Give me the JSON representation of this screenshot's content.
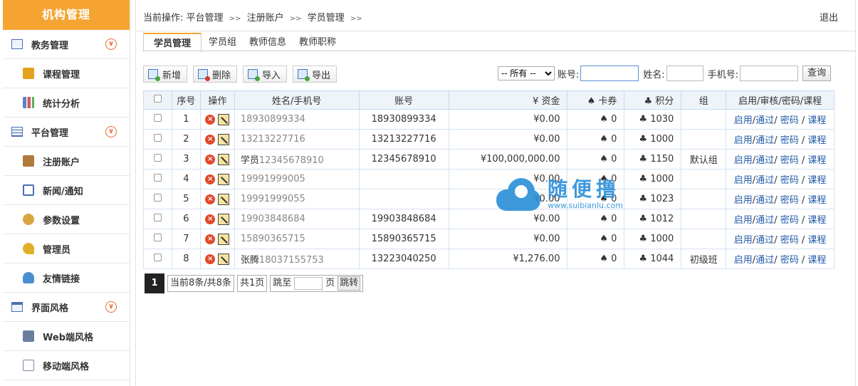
{
  "sidebar": {
    "brand": "机构管理",
    "groups": [
      {
        "label": "教务管理",
        "icon": "chart-doc-icon",
        "items": [
          {
            "label": "课程管理",
            "icon": "book-icon",
            "color": "#e3a21a"
          },
          {
            "label": "统计分析",
            "icon": "bar-chart-icon",
            "color": "#5b7fd0"
          }
        ]
      },
      {
        "label": "平台管理",
        "icon": "table-icon",
        "items": [
          {
            "label": "注册账户",
            "icon": "id-card-icon",
            "color": "#b07a3a"
          },
          {
            "label": "新闻/通知",
            "icon": "open-book-icon",
            "color": "#4a6fb0"
          },
          {
            "label": "参数设置",
            "icon": "gear-icon",
            "color": "#d9a640"
          },
          {
            "label": "管理员",
            "icon": "key-icon",
            "color": "#e0b02a"
          },
          {
            "label": "友情链接",
            "icon": "user-link-icon",
            "color": "#4a8fd0"
          }
        ]
      },
      {
        "label": "界面风格",
        "icon": "window-icon",
        "items": [
          {
            "label": "Web端风格",
            "icon": "monitor-icon",
            "color": "#6a7fa0"
          },
          {
            "label": "移动端风格",
            "icon": "line-chart-icon",
            "color": "#7a8aa0"
          }
        ]
      }
    ]
  },
  "header": {
    "crumb_prefix": "当前操作:",
    "crumbs": [
      "平台管理",
      "注册账户",
      "学员管理"
    ],
    "sep": ">>",
    "logout": "退出"
  },
  "tabs": [
    "学员管理",
    "学员组",
    "教师信息",
    "教师职称"
  ],
  "toolbar": {
    "add": "新增",
    "delete": "删除",
    "import": "导入",
    "export": "导出"
  },
  "filters": {
    "select": "-- 所有 --",
    "account_label": "账号:",
    "name_label": "姓名:",
    "phone_label": "手机号:",
    "search": "查询"
  },
  "table": {
    "headers": [
      "序号",
      "操作",
      "姓名/手机号",
      "账号",
      "¥ 资金",
      "♠ 卡券",
      "♣ 积分",
      "组",
      "启用/审核/密码/课程"
    ],
    "rows": [
      {
        "no": "1",
        "name": "",
        "phone": "18930899334",
        "account": "18930899334",
        "fund": "¥0.00",
        "card": "♠ 0",
        "points": "♣ 1030",
        "group": ""
      },
      {
        "no": "2",
        "name": "",
        "phone": "13213227716",
        "account": "13213227716",
        "fund": "¥0.00",
        "card": "♠ 0",
        "points": "♣ 1000",
        "group": ""
      },
      {
        "no": "3",
        "name": "学员",
        "phone": "12345678910",
        "account": "12345678910",
        "fund": "¥100,000,000.00",
        "card": "♠ 0",
        "points": "♣ 1150",
        "group": "默认组"
      },
      {
        "no": "4",
        "name": "",
        "phone": "19991999005",
        "account": "",
        "fund": "¥0.00",
        "card": "♠ 0",
        "points": "♣ 1000",
        "group": ""
      },
      {
        "no": "5",
        "name": "",
        "phone": "19991999055",
        "account": "",
        "fund": "¥0.00",
        "card": "♠ 0",
        "points": "♣ 1023",
        "group": ""
      },
      {
        "no": "6",
        "name": "",
        "phone": "19903848684",
        "account": "19903848684",
        "fund": "¥0.00",
        "card": "♠ 0",
        "points": "♣ 1012",
        "group": ""
      },
      {
        "no": "7",
        "name": "",
        "phone": "15890365715",
        "account": "15890365715",
        "fund": "¥0.00",
        "card": "♠ 0",
        "points": "♣ 1000",
        "group": ""
      },
      {
        "no": "8",
        "name": "张腾",
        "phone": "18037155753",
        "account": "13223040250",
        "fund": "¥1,276.00",
        "card": "♠ 0",
        "points": "♣ 1044",
        "group": "初级班"
      }
    ],
    "links": {
      "enable": "启用",
      "approve": "通过",
      "password": "密码",
      "course": "课程"
    }
  },
  "pager": {
    "current": "1",
    "summary": "当前8条/共8条",
    "pages": "共1页",
    "jump_to": "跳至",
    "page_unit": "页",
    "go": "跳转"
  },
  "watermark": {
    "cn": "随便撸",
    "en": "www.suibianlu.com"
  }
}
